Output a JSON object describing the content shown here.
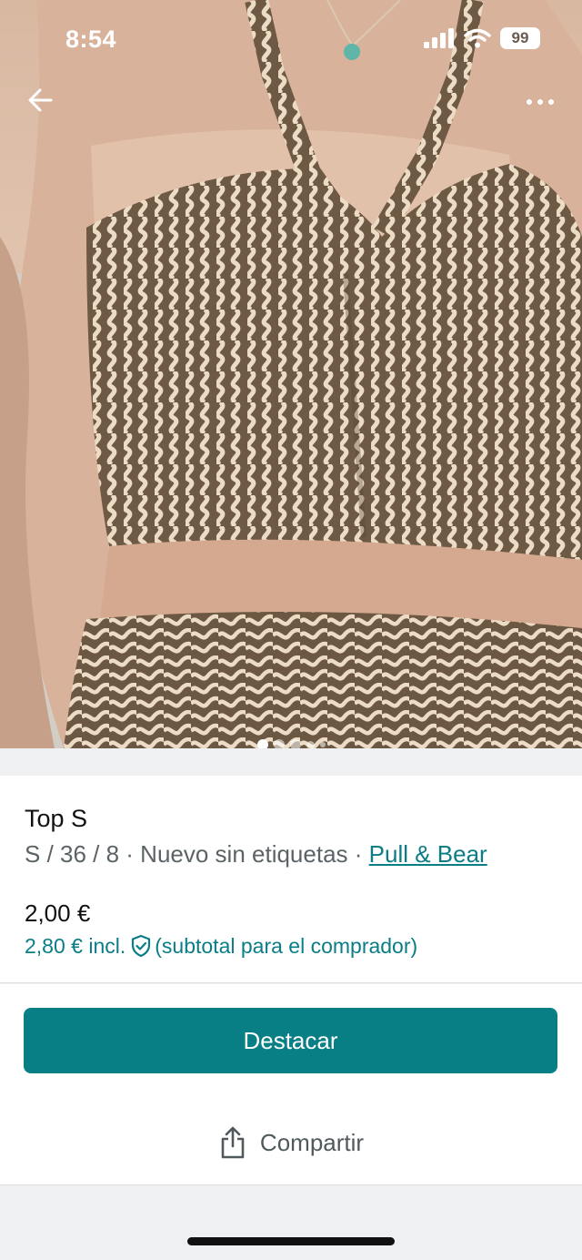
{
  "status_bar": {
    "time": "8:54",
    "battery": "99",
    "icons": [
      "cellular-signal-icon",
      "wifi-icon",
      "battery-icon"
    ]
  },
  "nav": {
    "back_icon": "arrow-left-icon",
    "more_icon": "more-horizontal-icon"
  },
  "gallery": {
    "image_count": 5,
    "active_index": 0
  },
  "item": {
    "title": "Top S",
    "details": "S / 36 / 8 · Nuevo sin etiquetas · ",
    "brand": "Pull & Bear",
    "price": "2,00 €",
    "price_incl": "2,80 € incl.",
    "price_incl_note": "(subtotal para el comprador)"
  },
  "actions": {
    "primary_label": "Destacar",
    "share_label": "Compartir"
  },
  "colors": {
    "accent": "#087e85",
    "link": "#0a7d87",
    "text_primary": "#111111",
    "text_secondary": "#5b6366",
    "background": "#eef0f1"
  }
}
